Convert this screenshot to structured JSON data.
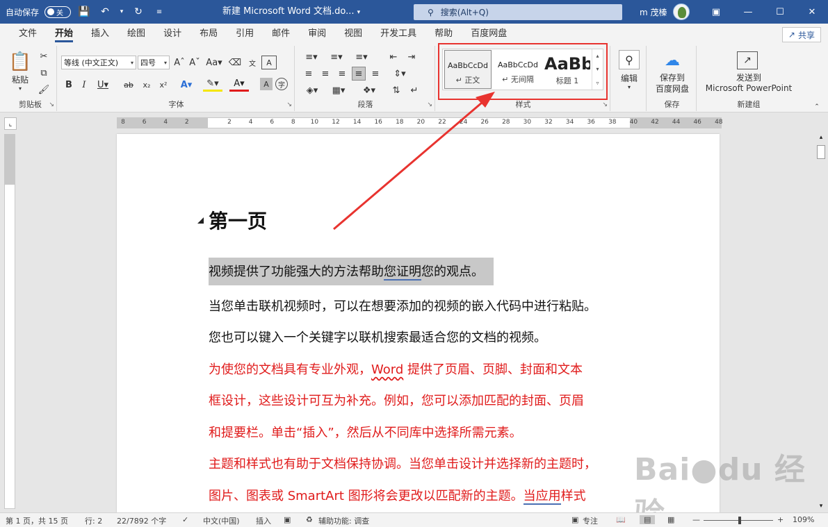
{
  "titlebar": {
    "autosave_label": "自动保存",
    "autosave_state": "关",
    "doc_title": "新建 Microsoft Word 文档.do...",
    "search_placeholder": "搜索(Alt+Q)",
    "user_name": "m 茂榛"
  },
  "tabs": [
    "文件",
    "开始",
    "插入",
    "绘图",
    "设计",
    "布局",
    "引用",
    "邮件",
    "审阅",
    "视图",
    "开发工具",
    "帮助",
    "百度网盘"
  ],
  "active_tab": "开始",
  "share_label": "共享",
  "ribbon": {
    "clipboard": {
      "paste_label": "粘贴",
      "group_label": "剪贴板"
    },
    "font": {
      "font_name": "等线 (中文正文)",
      "font_size": "四号",
      "group_label": "字体"
    },
    "paragraph": {
      "group_label": "段落"
    },
    "styles": {
      "group_label": "样式",
      "items": [
        {
          "preview": "AaBbCcDd",
          "name": "↵ 正文"
        },
        {
          "preview": "AaBbCcDd",
          "name": "↵ 无间隔"
        },
        {
          "preview": "AaBb",
          "name": "标题 1"
        }
      ]
    },
    "editing": {
      "label": "编辑"
    },
    "save": {
      "label_line1": "保存到",
      "label_line2": "百度网盘",
      "group_label": "保存"
    },
    "newgroup": {
      "label_line1": "发送到",
      "label_line2": "Microsoft PowerPoint",
      "group_label": "新建组"
    }
  },
  "ruler_numbers": [
    "8",
    "6",
    "4",
    "2",
    "2",
    "4",
    "6",
    "8",
    "10",
    "12",
    "14",
    "16",
    "18",
    "20",
    "22",
    "24",
    "26",
    "28",
    "30",
    "32",
    "34",
    "36",
    "38",
    "40",
    "42",
    "44",
    "46",
    "48"
  ],
  "document": {
    "heading": "第一页",
    "para1_a": "视频提供了功能强大的方法帮助",
    "para1_b": "您证明",
    "para1_c": "您的观点。",
    "para2": "当您单击联机视频时，可以在想要添加的视频的嵌入代码中进行粘贴。",
    "para3": "您也可以键入一个关键字以联机搜索最适合您的文档的视频。",
    "para4_a": "为使您的文档具有专业外观，",
    "para4_b": "Word",
    "para4_c": " 提供了页眉、页脚、封面和文本",
    "para5": "框设计，这些设计可互为补充。例如，您可以添加匹配的封面、页眉",
    "para6": "和提要栏。单击“插入”，然后从不同库中选择所需元素。",
    "para7": "主题和样式也有助于文档保持协调。当您单击设计并选择新的主题时，",
    "para8_a": "图片、图表或 SmartArt 图形将会更改以匹配新的主题。",
    "para8_b": "当应用",
    "para8_c": "样式"
  },
  "statusbar": {
    "page": "第 1 页，共 15 页",
    "line": "行: 2",
    "words": "22/7892 个字",
    "language": "中文(中国)",
    "insert": "插入",
    "accessibility": "辅助功能: 调查",
    "focus": "专注",
    "zoom": "109%"
  },
  "colors": {
    "titlebar": "#2b579a",
    "highlight_red": "#e8332f",
    "text_red": "#e01b1b"
  }
}
